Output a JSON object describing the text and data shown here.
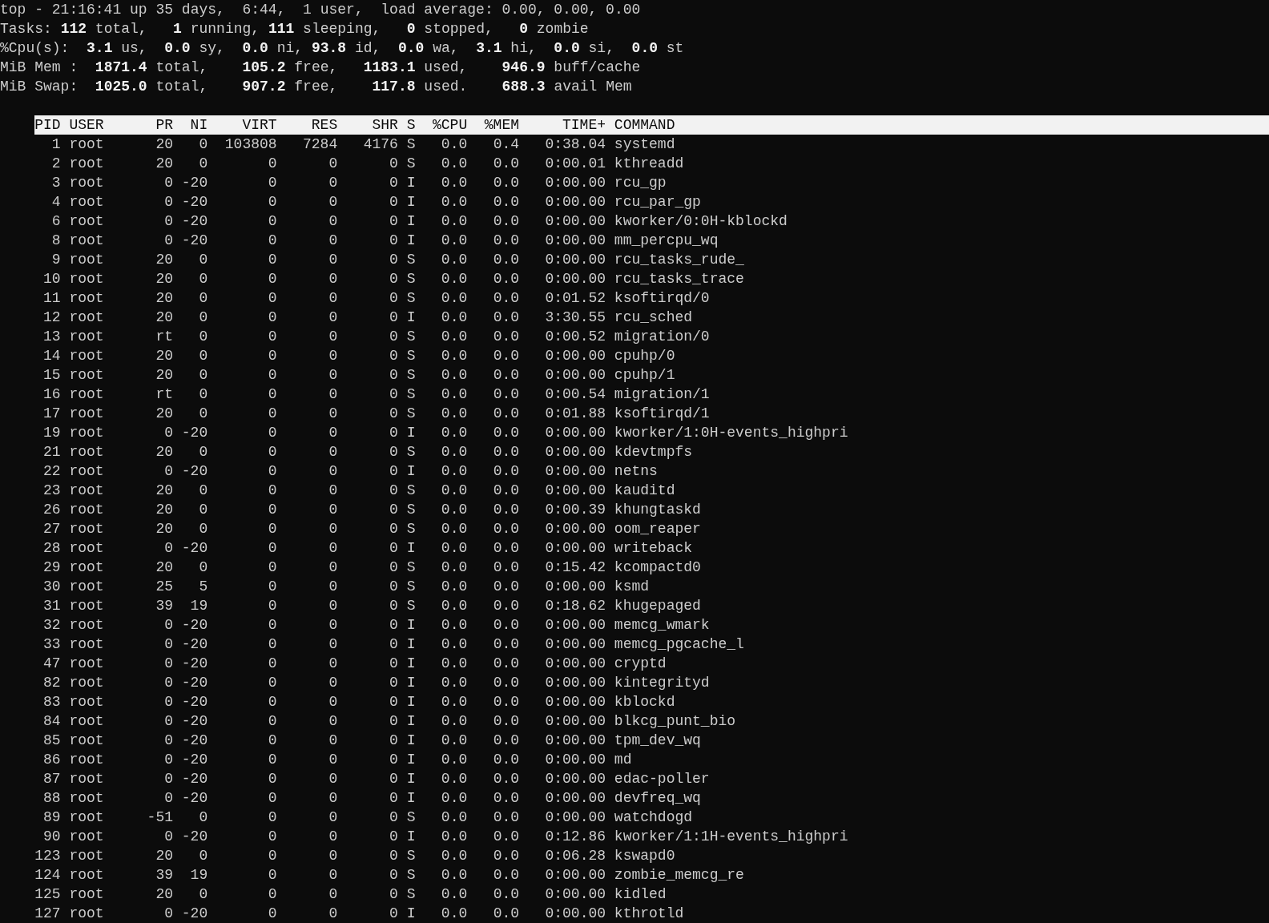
{
  "summary": [
    "top - 21:16:41 up 35 days,  6:44,  1 user,  load average: 0.00, 0.00, 0.00",
    "Tasks: **112** total,   **1** running, **111** sleeping,   **0** stopped,   **0** zombie",
    "%Cpu(s):  **3.1** us,  **0.0** sy,  **0.0** ni, **93.8** id,  **0.0** wa,  **3.1** hi,  **0.0** si,  **0.0** st",
    "MiB Mem :  **1871.4** total,    **105.2** free,   **1183.1** used,    **946.9** buff/cache",
    "MiB Swap:  **1025.0** total,    **907.2** free,    **117.8** used.    **688.3** avail Mem"
  ],
  "table": {
    "columns": [
      "PID",
      "USER",
      "PR",
      "NI",
      "VIRT",
      "RES",
      "SHR",
      "S",
      "%CPU",
      "%MEM",
      "TIME+",
      "COMMAND"
    ],
    "rows": [
      [
        "1",
        "root",
        "20",
        "0",
        "103808",
        "7284",
        "4176",
        "S",
        "0.0",
        "0.4",
        "0:38.04",
        "systemd"
      ],
      [
        "2",
        "root",
        "20",
        "0",
        "0",
        "0",
        "0",
        "S",
        "0.0",
        "0.0",
        "0:00.01",
        "kthreadd"
      ],
      [
        "3",
        "root",
        "0",
        "-20",
        "0",
        "0",
        "0",
        "I",
        "0.0",
        "0.0",
        "0:00.00",
        "rcu_gp"
      ],
      [
        "4",
        "root",
        "0",
        "-20",
        "0",
        "0",
        "0",
        "I",
        "0.0",
        "0.0",
        "0:00.00",
        "rcu_par_gp"
      ],
      [
        "6",
        "root",
        "0",
        "-20",
        "0",
        "0",
        "0",
        "I",
        "0.0",
        "0.0",
        "0:00.00",
        "kworker/0:0H-kblockd"
      ],
      [
        "8",
        "root",
        "0",
        "-20",
        "0",
        "0",
        "0",
        "I",
        "0.0",
        "0.0",
        "0:00.00",
        "mm_percpu_wq"
      ],
      [
        "9",
        "root",
        "20",
        "0",
        "0",
        "0",
        "0",
        "S",
        "0.0",
        "0.0",
        "0:00.00",
        "rcu_tasks_rude_"
      ],
      [
        "10",
        "root",
        "20",
        "0",
        "0",
        "0",
        "0",
        "S",
        "0.0",
        "0.0",
        "0:00.00",
        "rcu_tasks_trace"
      ],
      [
        "11",
        "root",
        "20",
        "0",
        "0",
        "0",
        "0",
        "S",
        "0.0",
        "0.0",
        "0:01.52",
        "ksoftirqd/0"
      ],
      [
        "12",
        "root",
        "20",
        "0",
        "0",
        "0",
        "0",
        "I",
        "0.0",
        "0.0",
        "3:30.55",
        "rcu_sched"
      ],
      [
        "13",
        "root",
        "rt",
        "0",
        "0",
        "0",
        "0",
        "S",
        "0.0",
        "0.0",
        "0:00.52",
        "migration/0"
      ],
      [
        "14",
        "root",
        "20",
        "0",
        "0",
        "0",
        "0",
        "S",
        "0.0",
        "0.0",
        "0:00.00",
        "cpuhp/0"
      ],
      [
        "15",
        "root",
        "20",
        "0",
        "0",
        "0",
        "0",
        "S",
        "0.0",
        "0.0",
        "0:00.00",
        "cpuhp/1"
      ],
      [
        "16",
        "root",
        "rt",
        "0",
        "0",
        "0",
        "0",
        "S",
        "0.0",
        "0.0",
        "0:00.54",
        "migration/1"
      ],
      [
        "17",
        "root",
        "20",
        "0",
        "0",
        "0",
        "0",
        "S",
        "0.0",
        "0.0",
        "0:01.88",
        "ksoftirqd/1"
      ],
      [
        "19",
        "root",
        "0",
        "-20",
        "0",
        "0",
        "0",
        "I",
        "0.0",
        "0.0",
        "0:00.00",
        "kworker/1:0H-events_highpri"
      ],
      [
        "21",
        "root",
        "20",
        "0",
        "0",
        "0",
        "0",
        "S",
        "0.0",
        "0.0",
        "0:00.00",
        "kdevtmpfs"
      ],
      [
        "22",
        "root",
        "0",
        "-20",
        "0",
        "0",
        "0",
        "I",
        "0.0",
        "0.0",
        "0:00.00",
        "netns"
      ],
      [
        "23",
        "root",
        "20",
        "0",
        "0",
        "0",
        "0",
        "S",
        "0.0",
        "0.0",
        "0:00.00",
        "kauditd"
      ],
      [
        "26",
        "root",
        "20",
        "0",
        "0",
        "0",
        "0",
        "S",
        "0.0",
        "0.0",
        "0:00.39",
        "khungtaskd"
      ],
      [
        "27",
        "root",
        "20",
        "0",
        "0",
        "0",
        "0",
        "S",
        "0.0",
        "0.0",
        "0:00.00",
        "oom_reaper"
      ],
      [
        "28",
        "root",
        "0",
        "-20",
        "0",
        "0",
        "0",
        "I",
        "0.0",
        "0.0",
        "0:00.00",
        "writeback"
      ],
      [
        "29",
        "root",
        "20",
        "0",
        "0",
        "0",
        "0",
        "S",
        "0.0",
        "0.0",
        "0:15.42",
        "kcompactd0"
      ],
      [
        "30",
        "root",
        "25",
        "5",
        "0",
        "0",
        "0",
        "S",
        "0.0",
        "0.0",
        "0:00.00",
        "ksmd"
      ],
      [
        "31",
        "root",
        "39",
        "19",
        "0",
        "0",
        "0",
        "S",
        "0.0",
        "0.0",
        "0:18.62",
        "khugepaged"
      ],
      [
        "32",
        "root",
        "0",
        "-20",
        "0",
        "0",
        "0",
        "I",
        "0.0",
        "0.0",
        "0:00.00",
        "memcg_wmark"
      ],
      [
        "33",
        "root",
        "0",
        "-20",
        "0",
        "0",
        "0",
        "I",
        "0.0",
        "0.0",
        "0:00.00",
        "memcg_pgcache_l"
      ],
      [
        "47",
        "root",
        "0",
        "-20",
        "0",
        "0",
        "0",
        "I",
        "0.0",
        "0.0",
        "0:00.00",
        "cryptd"
      ],
      [
        "82",
        "root",
        "0",
        "-20",
        "0",
        "0",
        "0",
        "I",
        "0.0",
        "0.0",
        "0:00.00",
        "kintegrityd"
      ],
      [
        "83",
        "root",
        "0",
        "-20",
        "0",
        "0",
        "0",
        "I",
        "0.0",
        "0.0",
        "0:00.00",
        "kblockd"
      ],
      [
        "84",
        "root",
        "0",
        "-20",
        "0",
        "0",
        "0",
        "I",
        "0.0",
        "0.0",
        "0:00.00",
        "blkcg_punt_bio"
      ],
      [
        "85",
        "root",
        "0",
        "-20",
        "0",
        "0",
        "0",
        "I",
        "0.0",
        "0.0",
        "0:00.00",
        "tpm_dev_wq"
      ],
      [
        "86",
        "root",
        "0",
        "-20",
        "0",
        "0",
        "0",
        "I",
        "0.0",
        "0.0",
        "0:00.00",
        "md"
      ],
      [
        "87",
        "root",
        "0",
        "-20",
        "0",
        "0",
        "0",
        "I",
        "0.0",
        "0.0",
        "0:00.00",
        "edac-poller"
      ],
      [
        "88",
        "root",
        "0",
        "-20",
        "0",
        "0",
        "0",
        "I",
        "0.0",
        "0.0",
        "0:00.00",
        "devfreq_wq"
      ],
      [
        "89",
        "root",
        "-51",
        "0",
        "0",
        "0",
        "0",
        "S",
        "0.0",
        "0.0",
        "0:00.00",
        "watchdogd"
      ],
      [
        "90",
        "root",
        "0",
        "-20",
        "0",
        "0",
        "0",
        "I",
        "0.0",
        "0.0",
        "0:12.86",
        "kworker/1:1H-events_highpri"
      ],
      [
        "123",
        "root",
        "20",
        "0",
        "0",
        "0",
        "0",
        "S",
        "0.0",
        "0.0",
        "0:06.28",
        "kswapd0"
      ],
      [
        "124",
        "root",
        "39",
        "19",
        "0",
        "0",
        "0",
        "S",
        "0.0",
        "0.0",
        "0:00.00",
        "zombie_memcg_re"
      ],
      [
        "125",
        "root",
        "20",
        "0",
        "0",
        "0",
        "0",
        "S",
        "0.0",
        "0.0",
        "0:00.00",
        "kidled"
      ],
      [
        "127",
        "root",
        "0",
        "-20",
        "0",
        "0",
        "0",
        "I",
        "0.0",
        "0.0",
        "0:00.00",
        "kthrotld"
      ]
    ]
  }
}
